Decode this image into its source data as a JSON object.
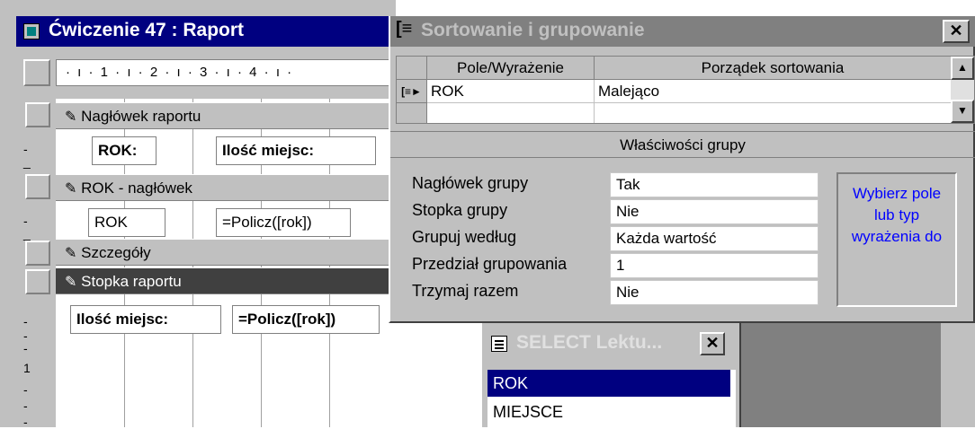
{
  "report_window": {
    "title": "Ćwiczenie 47 : Raport",
    "ruler": "· ı · 1 · ı · 2 · ı · 3 · ı · 4 · ı ·",
    "bands": {
      "report_header": "Nagłówek raportu",
      "group_header": "ROK - nagłówek",
      "detail": "Szczegóły",
      "report_footer": "Stopka raportu"
    },
    "controls": {
      "rok_label": "ROK:",
      "ilosc_label": "Ilość miejsc:",
      "rok_field": "ROK",
      "policz_field": "=Policz([rok])",
      "footer_label": "Ilość miejsc:",
      "footer_policz": "=Policz([rok])"
    },
    "vruler": {
      "one": "1"
    }
  },
  "sort_dialog": {
    "title": "Sortowanie i grupowanie",
    "col_field": "Pole/Wyrażenie",
    "col_order": "Porządek sortowania",
    "row1_field": "ROK",
    "row1_order": "Malejąco",
    "group_props_title": "Właściwości grupy",
    "props": {
      "header_label": "Nagłówek grupy",
      "header_value": "Tak",
      "footer_label": "Stopka grupy",
      "footer_value": "Nie",
      "group_on_label": "Grupuj według",
      "group_on_value": "Każda wartość",
      "interval_label": "Przedział grupowania",
      "interval_value": "1",
      "keep_label": "Trzymaj razem",
      "keep_value": "Nie"
    },
    "hint": "Wybierz pole lub typ wyrażenia do"
  },
  "field_list": {
    "title": "SELECT Lektu...",
    "items": [
      "ROK",
      "MIEJSCE"
    ]
  },
  "colors": {
    "titlebar": "#000080",
    "titlebar_inactive": "#808080",
    "hint_text": "#0000ff",
    "selection": "#000080"
  }
}
